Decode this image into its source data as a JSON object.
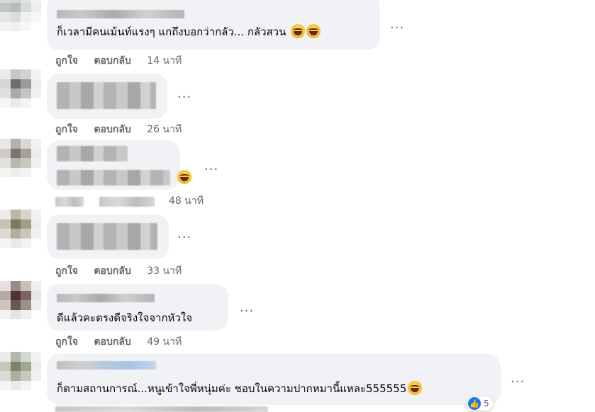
{
  "comments": [
    {
      "text": "ก็เวลามีคนเม้นท์แรงๆ แกถึงบอกว่ากลัว... กลัวสวน",
      "like_label": "ถูกใจ",
      "reply_label": "ตอบกลับ",
      "time": "14 นาที",
      "more_label": "..."
    },
    {
      "text": "",
      "like_label": "ถูกใจ",
      "reply_label": "ตอบกลับ",
      "time": "26 นาที",
      "more_label": "..."
    },
    {
      "text": "",
      "time": "48 นาที",
      "more_label": "..."
    },
    {
      "text": "",
      "like_label": "ถูกใจ",
      "reply_label": "ตอบกลับ",
      "time": "33 นาที",
      "more_label": "..."
    },
    {
      "text": "ดีแล้วคะตรงดีจริงใจจากหัวใจ",
      "like_label": "ถูกใจ",
      "reply_label": "ตอบกลับ",
      "time": "49 นาที",
      "more_label": "..."
    },
    {
      "text": "ก็ตามสถานการณ์...หนูเข้าใจพี่หนุ่มค่ะ ชอบในความปากหมานี้แหละ555555",
      "more_label": "...",
      "reaction_count": "5"
    }
  ],
  "colors": {
    "bubble": "#f0f2f5",
    "meta_text": "#65676b",
    "like_blue": "#1877f2"
  },
  "icons": {
    "emoji": "laughing-face-icon",
    "reaction": "thumbs-up-icon"
  }
}
